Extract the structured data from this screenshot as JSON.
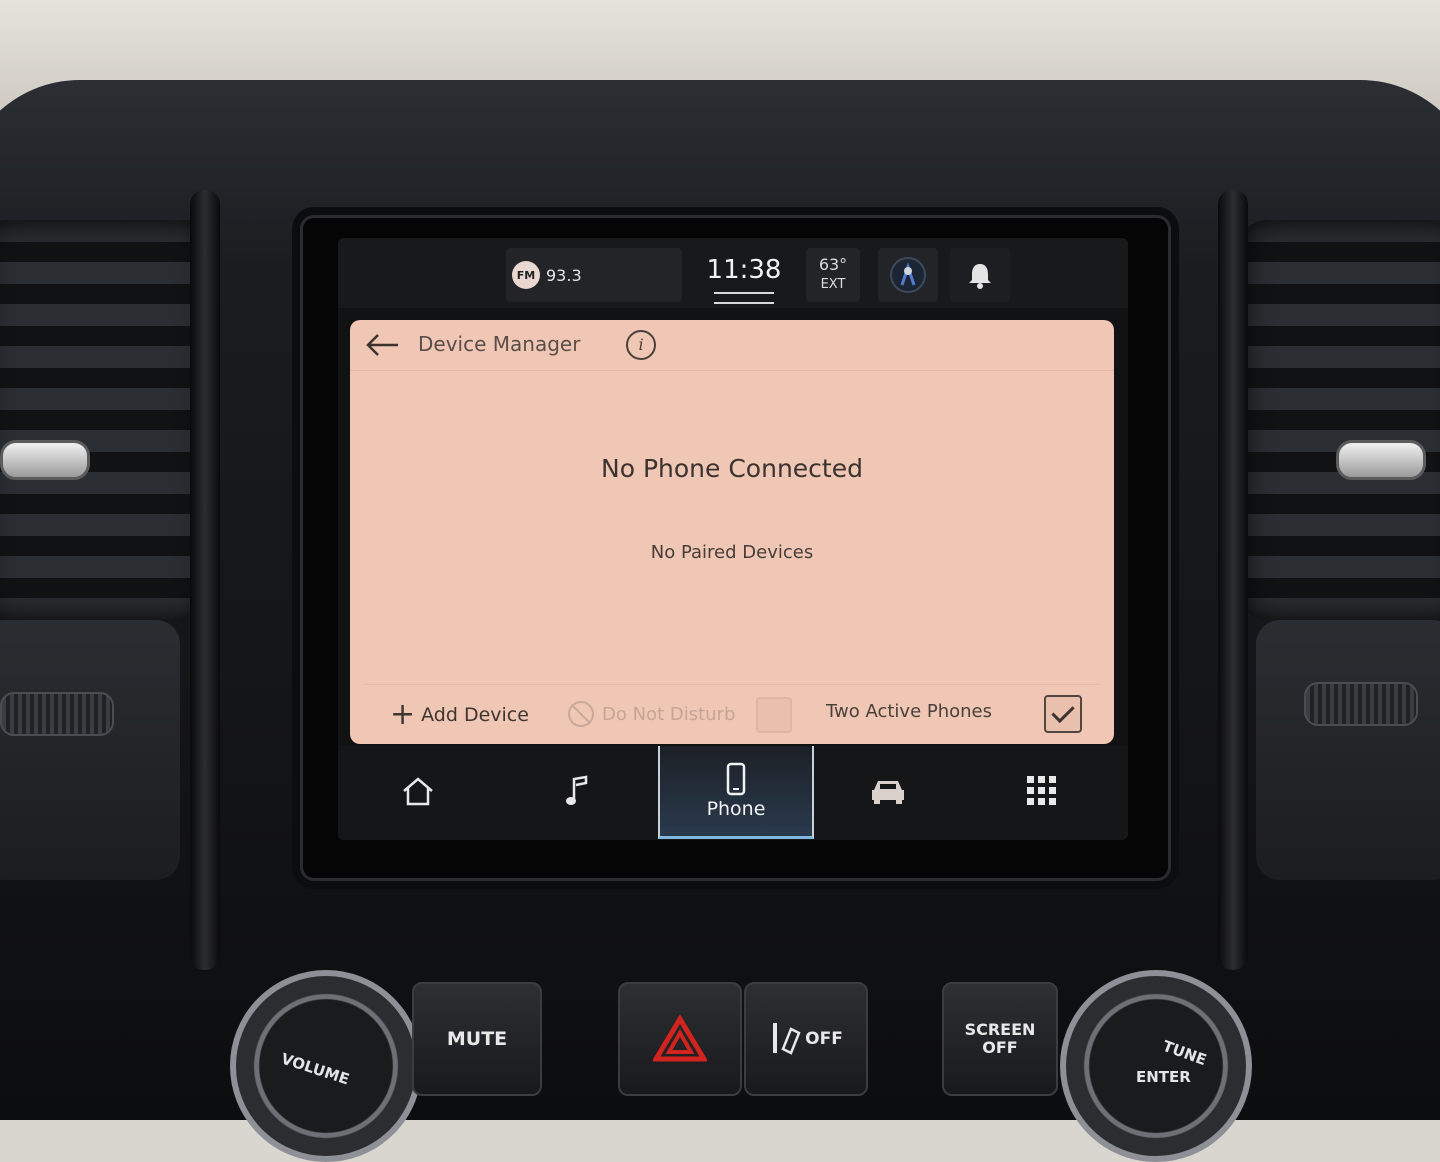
{
  "status_bar": {
    "radio_band": "FM",
    "radio_frequency": "93.3",
    "clock": "11:38",
    "temperature": "63°",
    "temperature_label": "EXT"
  },
  "screen": {
    "title": "Device Manager",
    "info_label": "i",
    "primary_message": "No Phone Connected",
    "secondary_message": "No Paired Devices",
    "footer": {
      "add_device_label": "Add Device",
      "do_not_disturb_label": "Do Not Disturb",
      "do_not_disturb_enabled": false,
      "do_not_disturb_checked": false,
      "two_active_phones_label": "Two Active Phones",
      "two_active_phones_checked": true
    }
  },
  "nav": {
    "items": [
      {
        "id": "home",
        "icon": "home-icon"
      },
      {
        "id": "media",
        "icon": "music-note-icon"
      },
      {
        "id": "phone",
        "icon": "phone-icon",
        "label": "Phone",
        "active": true
      },
      {
        "id": "vehicle",
        "icon": "car-icon"
      },
      {
        "id": "apps",
        "icon": "apps-grid-icon"
      }
    ]
  },
  "hardware": {
    "volume_label": "VOLUME",
    "mute_label": "MUTE",
    "traction_label": "OFF",
    "screen_off_line1": "SCREEN",
    "screen_off_line2": "OFF",
    "tune_label": "TUNE",
    "enter_label": "ENTER"
  },
  "colors": {
    "panel_background": "#f0c7b4",
    "active_tab_accent": "#7fb7e0",
    "hazard_red": "#d3231f"
  }
}
